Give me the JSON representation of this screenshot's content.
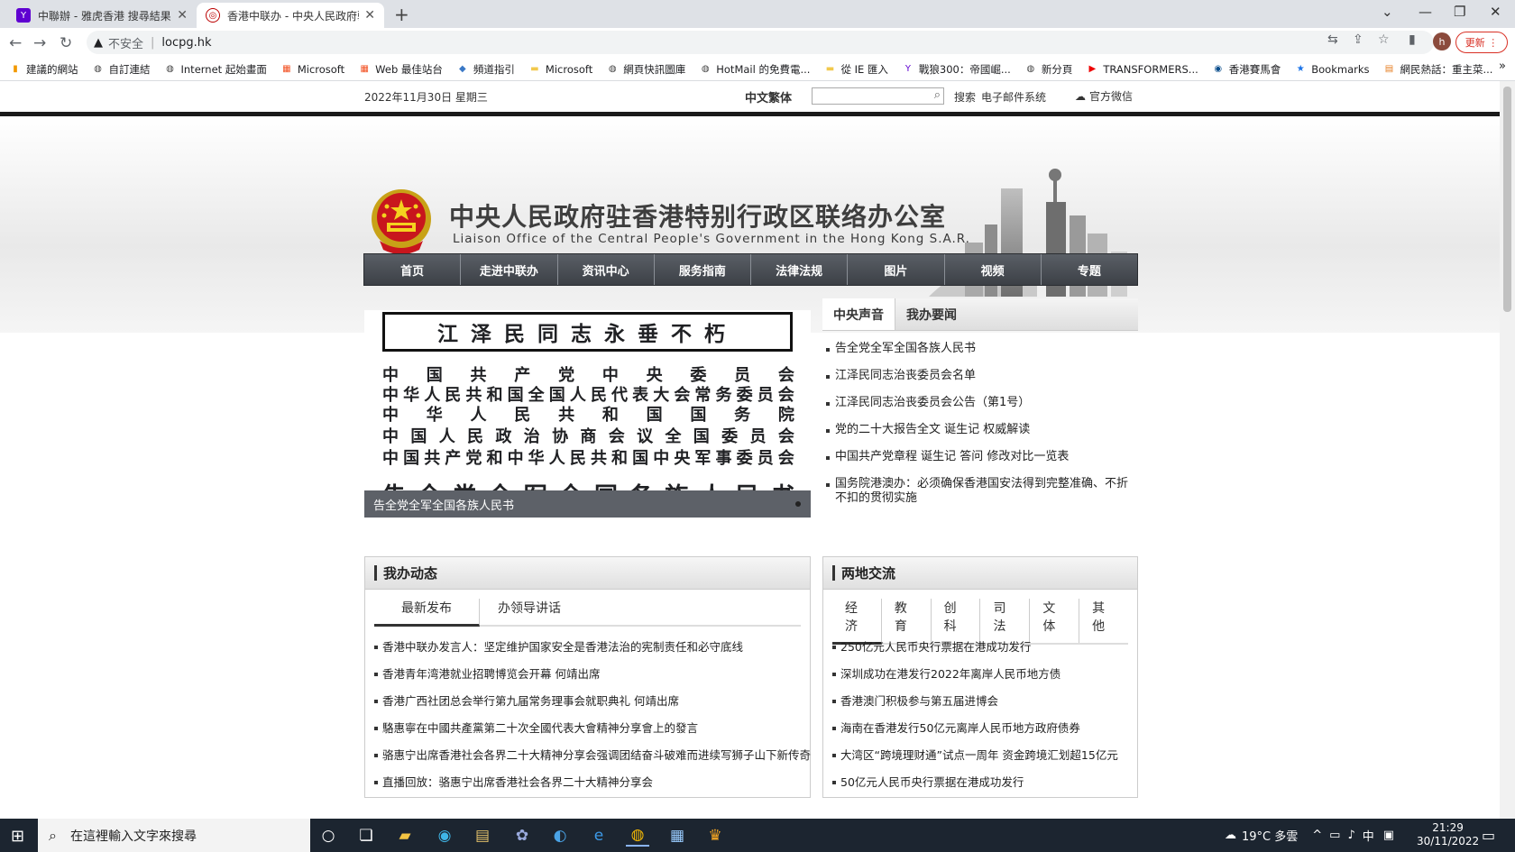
{
  "browser": {
    "tabs": [
      {
        "title": "中聯辦 - 雅虎香港 搜尋結果",
        "favicon": "yahoo-icon",
        "active": false
      },
      {
        "title": "香港中联办 - 中央人民政府驻香港特别行政区联络办公室",
        "favicon": "liaison-emblem-icon",
        "active": true
      }
    ],
    "new_tab": "+",
    "security_label": "不安全",
    "url": "locpg.hk",
    "update_label": "更新",
    "profile_initial": "h",
    "bookmarks": [
      {
        "label": "建議的網站",
        "icon": "bookmark-orange-icon"
      },
      {
        "label": "自訂連結",
        "icon": "globe-icon"
      },
      {
        "label": "Internet 起始畫面",
        "icon": "globe-icon"
      },
      {
        "label": "Microsoft",
        "icon": "microsoft-icon"
      },
      {
        "label": "Web 最佳站台",
        "icon": "microsoft-icon"
      },
      {
        "label": "頻道指引",
        "icon": "tag-icon"
      },
      {
        "label": "Microsoft",
        "icon": "folder-icon"
      },
      {
        "label": "網頁快訊圖庫",
        "icon": "globe-icon"
      },
      {
        "label": "HotMail 的免費電...",
        "icon": "globe-icon"
      },
      {
        "label": "從 IE 匯入",
        "icon": "folder-icon"
      },
      {
        "label": "戰狼300：帝國崛...",
        "icon": "yahoo-icon"
      },
      {
        "label": "新分頁",
        "icon": "globe-icon"
      },
      {
        "label": "TRANSFORMERS...",
        "icon": "youtube-icon"
      },
      {
        "label": "香港賽馬會",
        "icon": "hkjc-icon"
      },
      {
        "label": "Bookmarks",
        "icon": "star-icon"
      },
      {
        "label": "網民熱話：重主菜...",
        "icon": "page-icon"
      }
    ],
    "bookmarks_more": "»"
  },
  "site": {
    "date": "2022年11月30日  星期三",
    "lang": "中文繁体",
    "search_placeholder": "",
    "search_label": "搜索",
    "mail_label": "电子邮件系统",
    "wechat_label": "官方微信",
    "title_cn": "中央人民政府驻香港特别行政区联络办公室",
    "title_en": "Liaison Office of the Central People's Government in the Hong Kong S.A.R.",
    "nav": [
      "首页",
      "走进中联办",
      "资讯中心",
      "服务指南",
      "法律法规",
      "图片",
      "视频",
      "专题"
    ]
  },
  "hero": {
    "title": "江泽民同志永垂不朽",
    "orgs": [
      "中国共产党中央委员会",
      "中华人民共和国全国人民代表大会常务委员会",
      "中华人民共和国国务院",
      "中国人民政治协商会议全国委员会",
      "中国共产党和中华人民共和国中央军事委员会"
    ],
    "big": "告全党全军全国各族人民书",
    "caption": "告全党全军全国各族人民书"
  },
  "voice": {
    "tabs": [
      "中央声音",
      "我办要闻"
    ],
    "items": [
      "告全党全军全国各族人民书",
      "江泽民同志治丧委员会名单",
      "江泽民同志治丧委员会公告（第1号）",
      "党的二十大报告全文  诞生记  权威解读",
      "中国共产党章程  诞生记  答问  修改对比一览表",
      "国务院港澳办：必须确保香港国安法得到完整准确、不折不扣的贯彻实施"
    ]
  },
  "office_news": {
    "heading": "我办动态",
    "tabs": [
      "最新发布",
      "办领导讲话"
    ],
    "items": [
      "香港中联办发言人：坚定维护国家安全是香港法治的宪制责任和必守底线",
      "香港青年湾港就业招聘博览会开幕  何靖出席",
      "香港广西社团总会举行第九届常务理事会就职典礼  何靖出席",
      "駱惠寧在中國共產黨第二十次全國代表大會精神分享會上的發言",
      "骆惠宁出席香港社会各界二十大精神分享会强调团结奋斗破难而进续写狮子山下新传奇",
      "直播回放：骆惠宁出席香港社会各界二十大精神分享会"
    ]
  },
  "exchange": {
    "heading": "两地交流",
    "tabs": [
      "经济",
      "教育",
      "创科",
      "司法",
      "文体",
      "其他"
    ],
    "items": [
      "250亿元人民币央行票据在港成功发行",
      "深圳成功在港发行2022年离岸人民币地方债",
      "香港澳门积极参与第五届进博会",
      "海南在香港发行50亿元离岸人民币地方政府债券",
      "大湾区“跨境理财通”试点一周年  资金跨境汇划超15亿元",
      "50亿元人民币央行票据在港成功发行"
    ]
  },
  "taskbar": {
    "search_placeholder": "在這裡輸入文字來搜尋",
    "weather": "19°C  多雲",
    "ime": "中",
    "time": "21:29",
    "date": "30/11/2022"
  }
}
